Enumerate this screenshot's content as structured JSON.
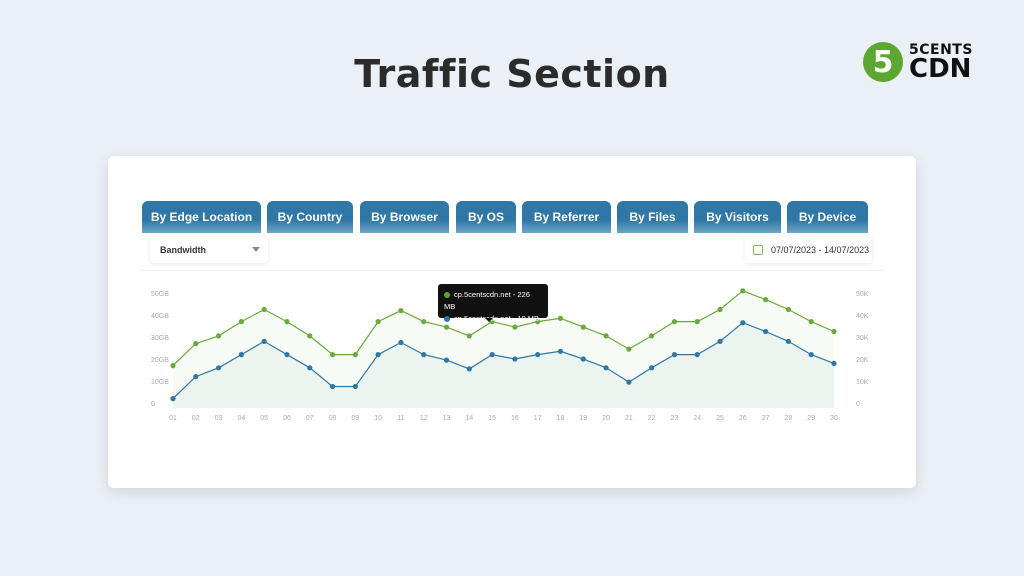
{
  "title": "Traffic Section",
  "logo": {
    "mark": "5",
    "line1": "5CENTS",
    "line2": "CDN",
    "color": "#5aa830"
  },
  "tabs": [
    "By Edge Location",
    "By Country",
    "By Browser",
    "By OS",
    "By Referrer",
    "By Files",
    "By Visitors",
    "By Device"
  ],
  "metric_select": {
    "value": "Bandwidth"
  },
  "date_range": {
    "icon": "calendar-icon",
    "value": "07/07/2023 - 14/07/2023"
  },
  "tooltip": {
    "rows": [
      {
        "label": "cp.5centscdn.net -  226 MB",
        "color": "#5aa830"
      },
      {
        "label": "cp.5centscdn.net -  10 MB",
        "color": "#2f77a6"
      }
    ]
  },
  "chart_data": {
    "type": "line",
    "categories": [
      "01",
      "02",
      "03",
      "04",
      "05",
      "06",
      "07",
      "08",
      "09",
      "10",
      "11",
      "12",
      "13",
      "14",
      "15",
      "16",
      "17",
      "18",
      "19",
      "20",
      "21",
      "22",
      "23",
      "24",
      "25",
      "26",
      "27",
      "28",
      "29",
      "30"
    ],
    "y_left_ticks": [
      "0",
      "10GB",
      "20GB",
      "30GB",
      "40GB",
      "50GB"
    ],
    "y_right_ticks": [
      "0",
      "10K",
      "20K",
      "30K",
      "40K",
      "50K"
    ],
    "ylim": [
      0,
      50
    ],
    "grid": false,
    "series": [
      {
        "color": "#6aaa3a",
        "values": [
          17,
          27,
          30.5,
          37,
          42.5,
          37,
          30.5,
          22,
          22,
          37,
          42,
          37,
          34.5,
          30.5,
          37,
          34.5,
          37,
          38.5,
          34.5,
          30.5,
          24.5,
          30.5,
          37,
          37,
          42.5,
          51,
          47,
          42.5,
          37,
          32.5
        ]
      },
      {
        "color": "#2f77a6",
        "values": [
          2,
          12,
          16,
          22,
          28,
          22,
          16,
          7.5,
          7.5,
          22,
          27.5,
          22,
          19.5,
          15.5,
          22,
          20,
          22,
          23.5,
          20,
          16,
          9.5,
          16,
          22,
          22,
          28,
          36.5,
          32.5,
          28,
          22,
          18
        ]
      }
    ]
  }
}
